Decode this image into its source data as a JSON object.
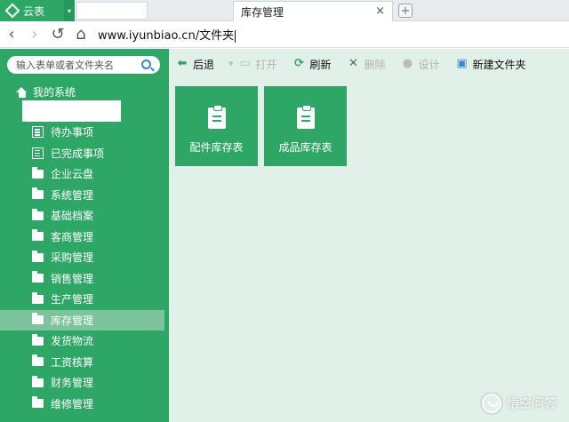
{
  "browser": {
    "brand_label": "云表",
    "active_tab": "库存管理",
    "close_glyph": "×",
    "new_tab_glyph": "+",
    "url": "www.iyunbiao.cn/文件夹"
  },
  "sidebar": {
    "search_placeholder": "输入表单或者文件夹名",
    "root_label": "我的系统",
    "items": [
      {
        "label": "待办事项",
        "icon": "doc-icon"
      },
      {
        "label": "已完成事项",
        "icon": "doc-icon"
      },
      {
        "label": "企业云盘",
        "icon": "folder-icon"
      },
      {
        "label": "系统管理",
        "icon": "folder-icon"
      },
      {
        "label": "基础档案",
        "icon": "folder-icon"
      },
      {
        "label": "客商管理",
        "icon": "folder-icon"
      },
      {
        "label": "采购管理",
        "icon": "folder-icon"
      },
      {
        "label": "销售管理",
        "icon": "folder-icon"
      },
      {
        "label": "生产管理",
        "icon": "folder-icon"
      },
      {
        "label": "库存管理",
        "icon": "folder-icon",
        "active": true
      },
      {
        "label": "发货物流",
        "icon": "folder-icon"
      },
      {
        "label": "工资核算",
        "icon": "folder-icon"
      },
      {
        "label": "财务管理",
        "icon": "folder-icon"
      },
      {
        "label": "维修管理",
        "icon": "folder-icon"
      }
    ]
  },
  "toolbar": {
    "back": "后退",
    "open": "打开",
    "refresh": "刷新",
    "delete": "删除",
    "design": "设计",
    "new_folder": "新建文件夹"
  },
  "tiles": [
    {
      "label": "配件库存表",
      "icon": "clipboard-icon"
    },
    {
      "label": "成品库存表",
      "icon": "clipboard-icon"
    }
  ],
  "watermark": "悟空问答",
  "colors": {
    "accent": "#2ea766",
    "main_bg": "#e1f0e9",
    "active_item": "#7dc49c"
  }
}
